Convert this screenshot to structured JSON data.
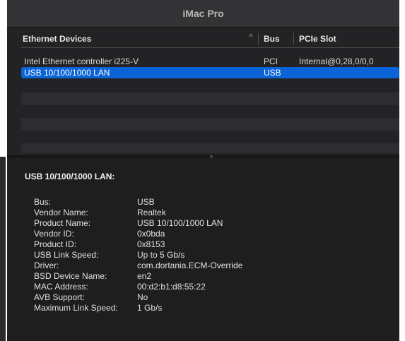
{
  "window": {
    "title": "iMac Pro"
  },
  "list": {
    "columns": {
      "devices": "Ethernet Devices",
      "bus": "Bus",
      "slot": "PCIe Slot"
    },
    "rows": [
      {
        "name": "Intel Ethernet controller i225-V",
        "bus": "PCI",
        "slot": "Internal@0,28,0/0,0"
      },
      {
        "name": "USB 10/100/1000 LAN",
        "bus": "USB",
        "slot": ""
      }
    ],
    "selected_index": 1
  },
  "detail": {
    "title": "USB 10/100/1000 LAN:",
    "properties": [
      {
        "key": "Bus:",
        "value": "USB"
      },
      {
        "key": "Vendor Name:",
        "value": "Realtek"
      },
      {
        "key": "Product Name:",
        "value": "USB 10/100/1000 LAN"
      },
      {
        "key": "Vendor ID:",
        "value": "0x0bda"
      },
      {
        "key": "Product ID:",
        "value": "0x8153"
      },
      {
        "key": "USB Link Speed:",
        "value": "Up to 5 Gb/s"
      },
      {
        "key": "Driver:",
        "value": "com.dortania.ECM-Override"
      },
      {
        "key": "BSD Device Name:",
        "value": "en2"
      },
      {
        "key": "MAC Address:",
        "value": "00:d2:b1:d8:55:22"
      },
      {
        "key": "AVB Support:",
        "value": "No"
      },
      {
        "key": "Maximum Link Speed:",
        "value": "1 Gb/s"
      }
    ]
  },
  "colors": {
    "selection": "#0a64d8",
    "window_bg": "#1e1e1e",
    "titlebar_bg": "#333335"
  }
}
